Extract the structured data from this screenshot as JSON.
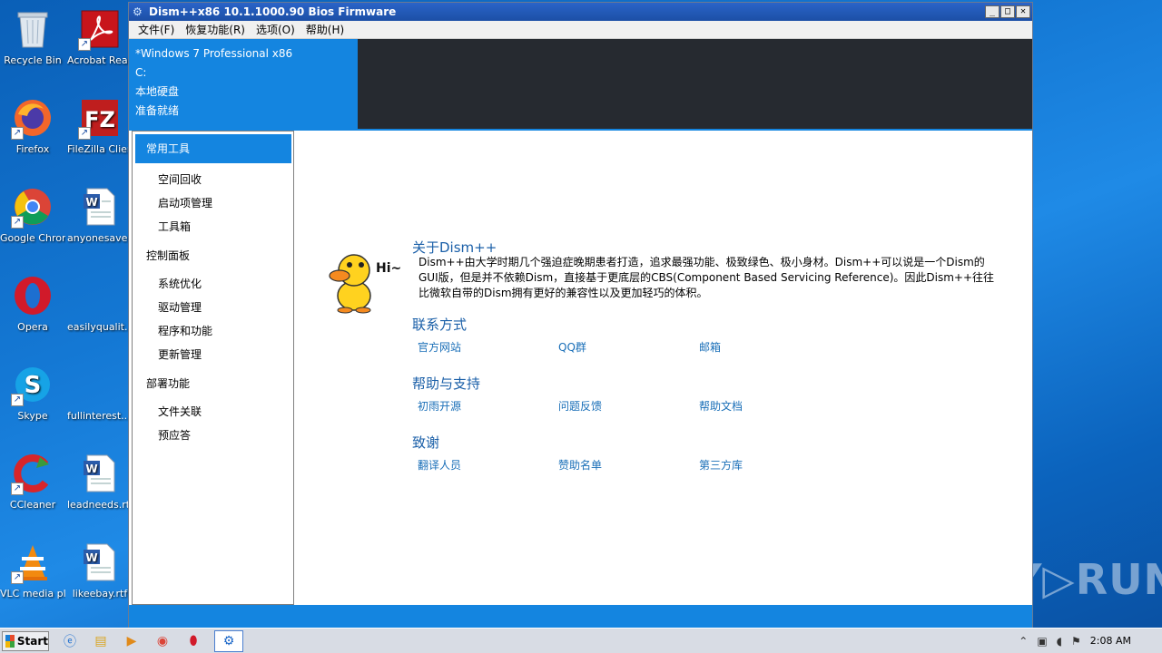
{
  "desktop": {
    "icons": [
      {
        "label": "Recycle Bin",
        "icon": "recycle-bin-icon"
      },
      {
        "label": "Acrobat Reader DC",
        "icon": "acrobat-icon"
      },
      {
        "label": "Firefox",
        "icon": "firefox-icon"
      },
      {
        "label": "FileZilla Client",
        "icon": "filezilla-icon"
      },
      {
        "label": "Google Chrome",
        "icon": "chrome-icon"
      },
      {
        "label": "anyonesave....",
        "icon": "word-doc-icon"
      },
      {
        "label": "Opera",
        "icon": "opera-icon"
      },
      {
        "label": "easilyqualit...",
        "icon": "blank-file-icon"
      },
      {
        "label": "Skype",
        "icon": "skype-icon"
      },
      {
        "label": "fullinterest....",
        "icon": "blank-file-icon"
      },
      {
        "label": "CCleaner",
        "icon": "ccleaner-icon"
      },
      {
        "label": "leadneeds.rtf",
        "icon": "word-doc-icon"
      },
      {
        "label": "VLC media player",
        "icon": "vlc-icon"
      },
      {
        "label": "likeebay.rtf",
        "icon": "word-doc-icon"
      }
    ]
  },
  "window": {
    "title": "Dism++x86 10.1.1000.90 Bios Firmware",
    "menu": [
      "文件(F)",
      "恢复功能(R)",
      "选项(O)",
      "帮助(H)"
    ],
    "info": {
      "os": "*Windows 7 Professional x86",
      "drive": "C:",
      "disk": "本地硬盘",
      "status": "准备就绪"
    },
    "sidebar": {
      "selected": "常用工具",
      "group1_items": [
        "空间回收",
        "启动项管理",
        "工具箱"
      ],
      "group2_title": "控制面板",
      "group2_items": [
        "系统优化",
        "驱动管理",
        "程序和功能",
        "更新管理"
      ],
      "group3_title": "部署功能",
      "group3_items": [
        "文件关联",
        "预应答"
      ]
    },
    "about": {
      "title": "关于Dism++",
      "text": "Dism++由大学时期几个强迫症晚期患者打造，追求最强功能、极致绿色、极小身材。Dism++可以说是一个Dism的GUI版，但是并不依赖Dism，直接基于更底层的CBS(Component Based Servicing Reference)。因此Dism++往往比微软自带的Dism拥有更好的兼容性以及更加轻巧的体积。",
      "hi": "Hi~"
    },
    "contact": {
      "title": "联系方式",
      "links": [
        "官方网站",
        "QQ群",
        "邮箱"
      ]
    },
    "support": {
      "title": "帮助与支持",
      "links": [
        "初雨开源",
        "问题反馈",
        "帮助文档"
      ]
    },
    "thanks": {
      "title": "致谢",
      "links": [
        "翻译人员",
        "赞助名单",
        "第三方库"
      ]
    }
  },
  "taskbar": {
    "start": "Start",
    "clock": "2:08 AM"
  },
  "watermark": "ANY▷RUN"
}
